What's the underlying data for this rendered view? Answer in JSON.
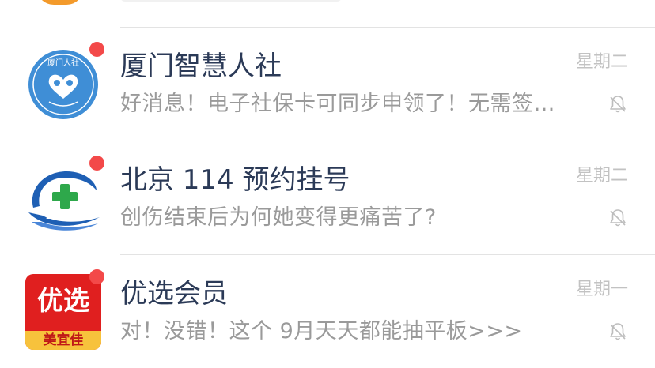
{
  "chats": [
    {
      "title": "厦门智慧人社",
      "preview": "好消息！电子社保卡可同步申领了！无需签…",
      "time": "星期二",
      "avatar": "xiamen-hrss-logo",
      "unread": true,
      "muted": true
    },
    {
      "title": "北京 114 预约挂号",
      "preview": "创伤结束后为何她变得更痛苦了?",
      "time": "星期二",
      "avatar": "beijing-114-logo",
      "unread": true,
      "muted": true
    },
    {
      "title": "优选会员",
      "preview": "对！没错！这个 9月天天都能抽平板>>>",
      "time": "星期一",
      "avatar": "youxuan-logo",
      "avatar_text_top": "优选",
      "avatar_text_bottom": "美宜佳",
      "unread": true,
      "muted": true
    }
  ],
  "colors": {
    "title": "#2b3a57",
    "preview": "#9a9a9a",
    "badge": "#f34949",
    "youxuan_red": "#e01f1f",
    "youxuan_yellow": "#f7c23c"
  }
}
